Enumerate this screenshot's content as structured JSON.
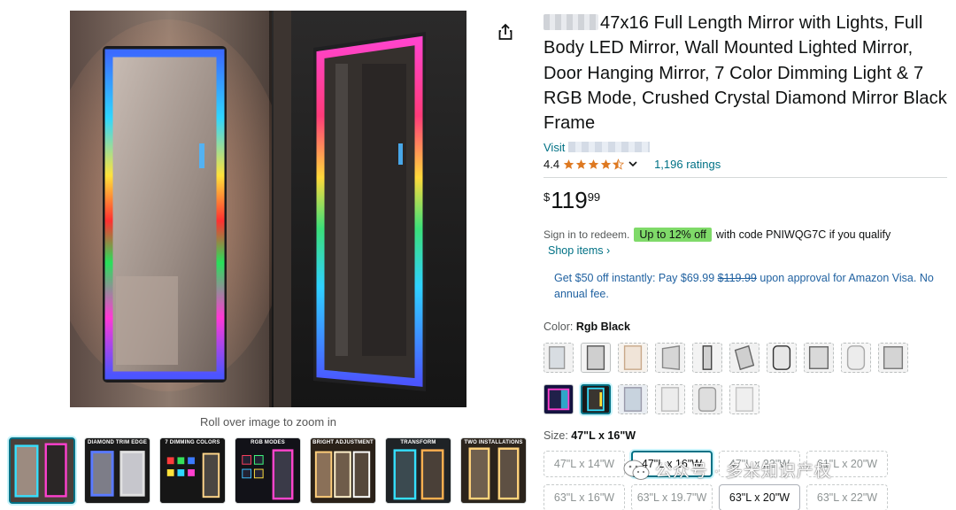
{
  "gallery": {
    "zoom_hint": "Roll over image to zoom in",
    "thumbnails": [
      {
        "caption": ""
      },
      {
        "caption": "DIAMOND TRIM EDGE"
      },
      {
        "caption": "7 DIMMING COLORS"
      },
      {
        "caption": "RGB MODES"
      },
      {
        "caption": "BRIGHT ADJUSTMENT"
      },
      {
        "caption": "TRANSFORM"
      },
      {
        "caption": "TWO INSTALLATIONS"
      }
    ]
  },
  "product": {
    "title": "47x16 Full Length Mirror with Lights, Full Body LED Mirror, Wall Mounted Lighted Mirror, Door Hanging Mirror, 7 Color Dimming Light & 7 RGB Mode, Crushed Crystal Diamond Mirror Black Frame",
    "visit_prefix": "Visit",
    "rating_value": "4.4",
    "ratings_count": "1,196 ratings",
    "price_symbol": "$",
    "price_whole": "119",
    "price_fraction": "99"
  },
  "coupon": {
    "signin_text": "Sign in to redeem.",
    "badge": "Up to 12% off",
    "code_text": "with code PNIWQG7C if you qualify",
    "shop_items": "Shop items ›"
  },
  "promo": {
    "lead": "Get $50 off instantly: Pay $69.99",
    "strike": "$119.99",
    "tail": "upon approval for Amazon Visa. No annual fee."
  },
  "color": {
    "label": "Color:",
    "selected": "Rgb Black"
  },
  "size": {
    "label": "Size:",
    "selected": "47\"L x 16\"W",
    "options": [
      {
        "label": "47\"L x 14\"W",
        "state": "unavailable"
      },
      {
        "label": "47\"L x 16\"W",
        "state": "selected"
      },
      {
        "label": "47\"L x 22\"W",
        "state": "unavailable"
      },
      {
        "label": "61\"L x 20\"W",
        "state": "unavailable"
      },
      {
        "label": "63\"L x 16\"W",
        "state": "unavailable"
      },
      {
        "label": "63\"L x 19.7\"W",
        "state": "unavailable"
      },
      {
        "label": "63\"L x 20\"W",
        "state": "available"
      },
      {
        "label": "63\"L x 22\"W",
        "state": "unavailable"
      }
    ]
  },
  "watermark": {
    "text": "公众号 · 多米知识产权"
  },
  "colors": {
    "link": "#007185",
    "promo": "#2162a1",
    "badge": "#7fda69",
    "star": "#de7921"
  }
}
